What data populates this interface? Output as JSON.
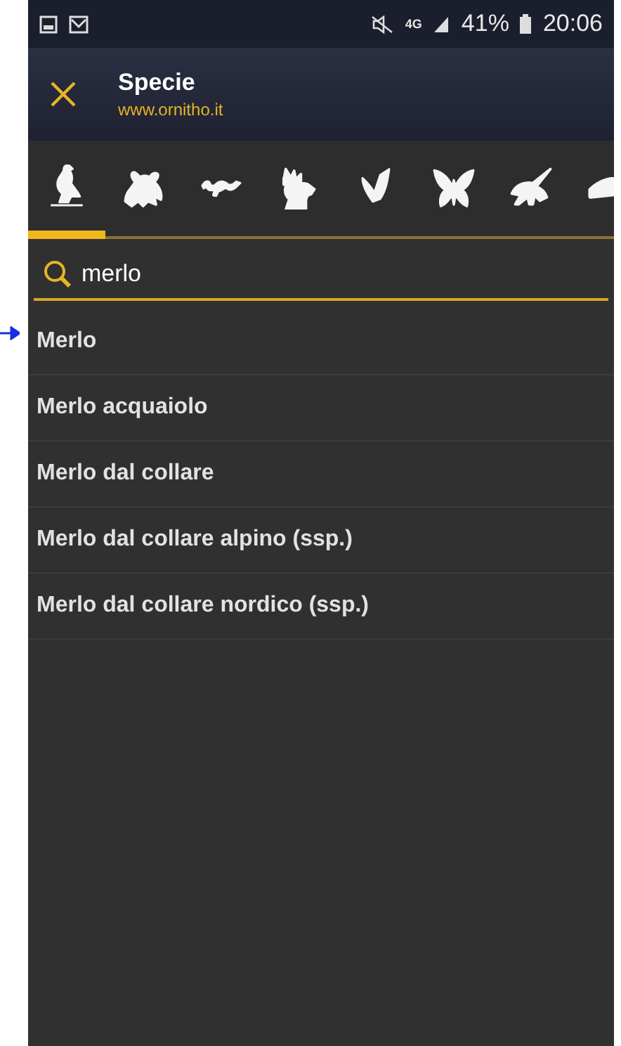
{
  "status_bar": {
    "network": "4G",
    "battery": "41%",
    "time": "20:06"
  },
  "app_bar": {
    "title": "Specie",
    "subtitle": "www.ornitho.it"
  },
  "tabs": [
    {
      "selected": true
    },
    {
      "selected": false
    },
    {
      "selected": false
    },
    {
      "selected": false
    },
    {
      "selected": false
    },
    {
      "selected": false
    },
    {
      "selected": false
    },
    {
      "selected": false
    }
  ],
  "search": {
    "value": "merlo"
  },
  "results": [
    "Merlo",
    "Merlo acquaiolo",
    "Merlo dal collare",
    "Merlo dal collare alpino (ssp.)",
    "Merlo dal collare nordico (ssp.)"
  ]
}
